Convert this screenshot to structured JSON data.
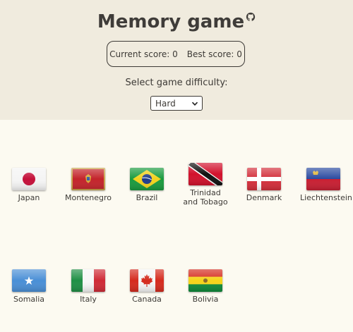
{
  "header": {
    "title": "Memory game",
    "current_score_label": "Current score: 0",
    "best_score_label": "Best score: 0",
    "difficulty_label": "Select game difficulty:",
    "difficulty_selected": "Hard",
    "github_icon": "github-icon"
  },
  "cards": [
    {
      "label": "Japan"
    },
    {
      "label": "Montenegro"
    },
    {
      "label": "Brazil"
    },
    {
      "label": "Trinidad and Tobago"
    },
    {
      "label": "Denmark"
    },
    {
      "label": "Liechtenstein"
    },
    {
      "label": "Somalia"
    },
    {
      "label": "Italy"
    },
    {
      "label": "Canada"
    },
    {
      "label": "Bolivia"
    }
  ]
}
